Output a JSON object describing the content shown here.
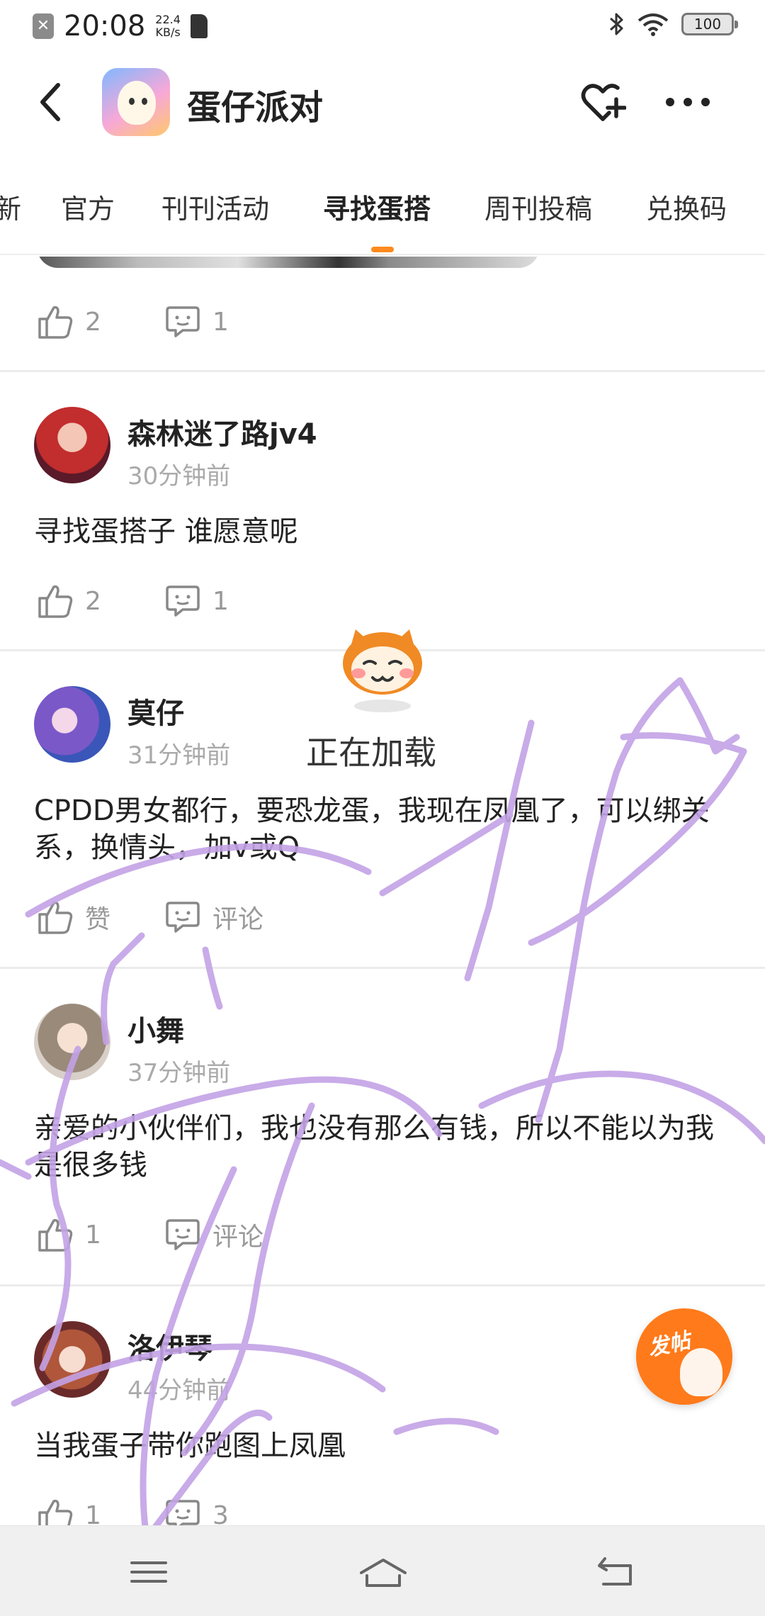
{
  "status_bar": {
    "time": "20:08",
    "net_speed_value": "22.4",
    "net_speed_unit": "KB/s",
    "battery": "100"
  },
  "header": {
    "title": "蛋仔派对"
  },
  "tabs": [
    {
      "label": "新",
      "active": false
    },
    {
      "label": "官方",
      "active": false
    },
    {
      "label": "刊刊活动",
      "active": false
    },
    {
      "label": "寻找蛋搭",
      "active": true
    },
    {
      "label": "周刊投稿",
      "active": false
    },
    {
      "label": "兑换码",
      "active": false
    }
  ],
  "accent_color": "#ff8a1f",
  "posts": [
    {
      "partial": true,
      "likes": "2",
      "comments": "1"
    },
    {
      "author": "森林迷了路jv4",
      "time": "30分钟前",
      "content": "寻找蛋搭子 谁愿意呢",
      "likes": "2",
      "comments": "1"
    },
    {
      "author": "莫仔",
      "time": "31分钟前",
      "content": "CPDD男女都行，要恐龙蛋，我现在凤凰了，可以绑关系，换情头，加v或Q",
      "likes": "赞",
      "comments": "评论"
    },
    {
      "author": "小舞",
      "time": "37分钟前",
      "content": "亲爱的小伙伴们，我也没有那么有钱，所以不能以为我是很多钱",
      "likes": "1",
      "comments": "评论"
    },
    {
      "author": "洛伊琴",
      "time": "44分钟前",
      "content": "当我蛋子带你跑图上凤凰",
      "likes": "1",
      "comments": "3"
    }
  ],
  "loading": {
    "text": "正在加载"
  },
  "fab": {
    "label": "发帖"
  },
  "icons": {
    "back": "chevron-left-icon",
    "favorite": "heart-plus-icon",
    "more": "more-dots-icon",
    "like": "thumbs-up-icon",
    "comment": "comment-icon"
  }
}
